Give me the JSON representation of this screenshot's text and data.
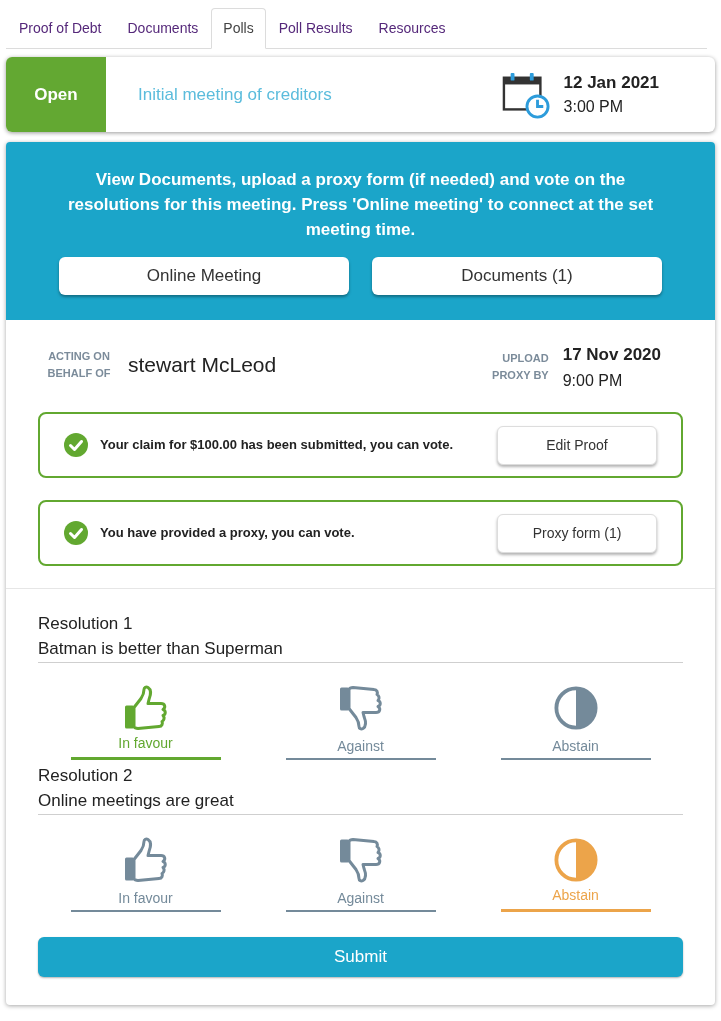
{
  "tabs": [
    {
      "label": "Proof of Debt",
      "selected": false
    },
    {
      "label": "Documents",
      "selected": false
    },
    {
      "label": "Polls",
      "selected": true
    },
    {
      "label": "Poll Results",
      "selected": false
    },
    {
      "label": "Resources",
      "selected": false
    }
  ],
  "meeting": {
    "status": "Open",
    "title": "Initial meeting of creditors",
    "date": "12 Jan 2021",
    "time": "3:00 PM"
  },
  "banner": {
    "message": "View Documents, upload a proxy form (if needed) and vote on the resolutions for this meeting. Press 'Online meeting' to connect at the set meeting time.",
    "buttons": [
      "Online Meeting",
      "Documents (1)"
    ]
  },
  "acting": {
    "label": "ACTING ON BEHALF OF",
    "name": "stewart McLeod"
  },
  "proxy_deadline": {
    "label": "UPLOAD PROXY BY",
    "date": "17 Nov 2020",
    "time": "9:00 PM"
  },
  "notices": [
    {
      "text": "Your claim for $100.00 has been submitted, you can vote.",
      "complete": true,
      "button": "Edit Proof"
    },
    {
      "text": "You have provided a proxy, you can vote.",
      "complete": true,
      "button": "Proxy form (1)"
    }
  ],
  "resolutions": [
    {
      "title": "Resolution 1",
      "text": "Batman is better than Superman",
      "options": [
        {
          "kind": "for",
          "label": "In favour",
          "selected": true
        },
        {
          "kind": "against",
          "label": "Against",
          "selected": false
        },
        {
          "kind": "abstain",
          "label": "Abstain",
          "selected": false
        }
      ]
    },
    {
      "title": "Resolution 2",
      "text": "Online meetings are great",
      "options": [
        {
          "kind": "for",
          "label": "In favour",
          "selected": false
        },
        {
          "kind": "against",
          "label": "Against",
          "selected": false
        },
        {
          "kind": "abstain",
          "label": "Abstain",
          "selected": true
        }
      ]
    }
  ],
  "submit": "Submit"
}
